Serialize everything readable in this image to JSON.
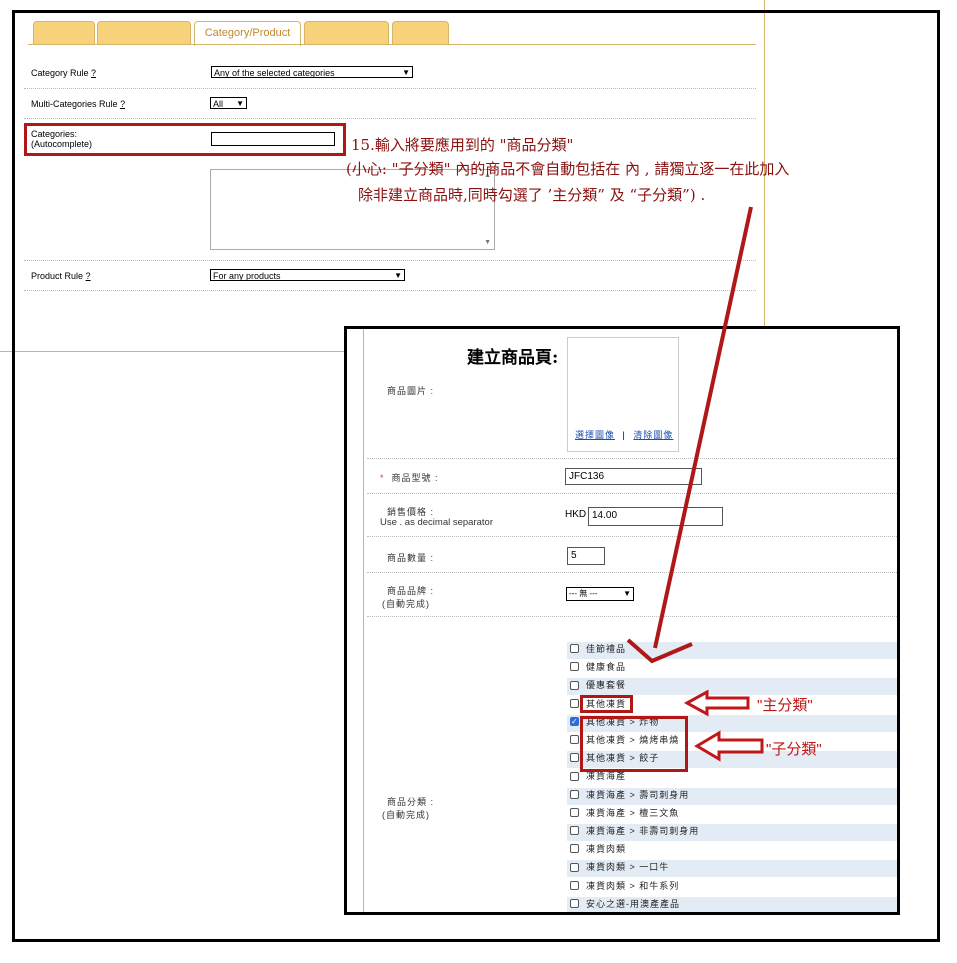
{
  "tabs": [
    "",
    "",
    "Category/Product",
    "",
    ""
  ],
  "form": {
    "category_rule": {
      "label": "Category Rule",
      "help": "?",
      "value": "Any of the selected categories"
    },
    "multi_rule": {
      "label": "Multi-Categories Rule",
      "help": "?",
      "value": "All"
    },
    "categories": {
      "label": "Categories:",
      "sub": "(Autocomplete)"
    },
    "product_rule": {
      "label": "Product Rule",
      "help": "?",
      "value": "For any products"
    }
  },
  "note": {
    "line1": "15.輸入將要應用到的 \"商品分類\"",
    "line2": "(小心: \"子分類\" 內的商品不會自動包括在 內 , 請獨立逐一在此加入",
    "line3": "除非建立商品時,同時勾選了 ’主分類” 及 “子分類”) ."
  },
  "inset": {
    "title": "建立商品頁:",
    "image_label": "商品圖片 :",
    "image_links": {
      "choose": "選擇圖像",
      "sep": "|",
      "clear": "清除圖像"
    },
    "model": {
      "req": "*",
      "label": "商品型號 :",
      "value": "JFC136"
    },
    "price": {
      "label": "銷售價格 :",
      "hint": "Use . as decimal separator",
      "currency": "HKD",
      "value": "14.00"
    },
    "qty": {
      "label": "商品數量 :",
      "value": "5"
    },
    "brand": {
      "label": "商品品牌 :",
      "sub": "(自動完成)",
      "value": "--- 無 ---"
    },
    "categories": {
      "label": "商品分類 :",
      "sub": "(自動完成)",
      "items": [
        {
          "text": "佳節禮品",
          "checked": false
        },
        {
          "text": "健康食品",
          "checked": false
        },
        {
          "text": "優惠套餐",
          "checked": false
        },
        {
          "text": "其他凍貨",
          "checked": false
        },
        {
          "text": "其他凍貨 > 炸物",
          "checked": true
        },
        {
          "text": "其他凍貨 > 燒烤串燒",
          "checked": false
        },
        {
          "text": "其他凍貨 > 餃子",
          "checked": false
        },
        {
          "text": "凍貨海產",
          "checked": false
        },
        {
          "text": "凍貨海產 > 壽司刺身用",
          "checked": false
        },
        {
          "text": "凍貨海產 > 檀三文魚",
          "checked": false
        },
        {
          "text": "凍貨海產 > 非壽司刺身用",
          "checked": false
        },
        {
          "text": "凍貨肉類",
          "checked": false
        },
        {
          "text": "凍貨肉類 > 一口牛",
          "checked": false
        },
        {
          "text": "凍貨肉類 > 和牛系列",
          "checked": false
        },
        {
          "text": "安心之選-用澳產產品",
          "checked": false
        }
      ]
    }
  },
  "annotations": {
    "main": "\"主分類\"",
    "sub": "\"子分類\""
  },
  "colors": {
    "annotation_red": "#b01818",
    "tab_gold": "#f7d27a",
    "row_shade": "#e3ecf5"
  }
}
